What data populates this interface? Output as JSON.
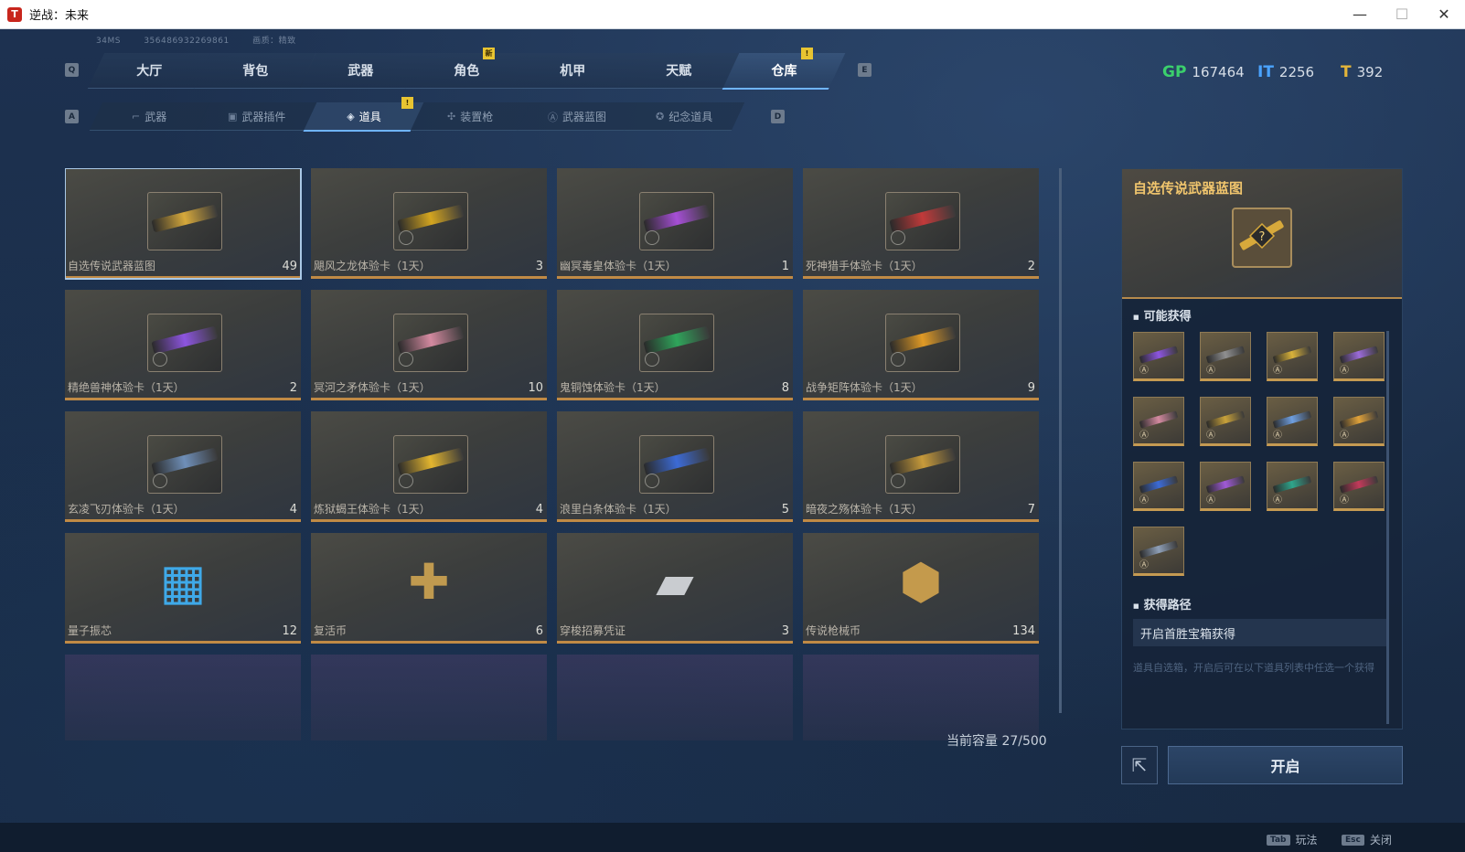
{
  "window": {
    "title": "逆战：未来",
    "app_icon_glyph": "T"
  },
  "top_info": {
    "ping": "34MS",
    "id": "356486932269861",
    "quality": "画质：精致"
  },
  "keys": {
    "prev_tab": "Q",
    "next_tab": "E",
    "prev_sub": "A",
    "next_sub": "D"
  },
  "nav": {
    "tabs": [
      {
        "label": "大厅",
        "active": false
      },
      {
        "label": "背包",
        "active": false
      },
      {
        "label": "武器",
        "active": false
      },
      {
        "label": "角色",
        "active": false,
        "badge": "新"
      },
      {
        "label": "机甲",
        "active": false
      },
      {
        "label": "天赋",
        "active": false
      },
      {
        "label": "仓库",
        "active": true,
        "badge": "!"
      }
    ]
  },
  "currencies": [
    {
      "icon": "gp-icon",
      "symbol": "GP",
      "value": "167464",
      "color": "#3bd06c"
    },
    {
      "icon": "ticket-icon",
      "symbol": "IT",
      "value": "2256",
      "color": "#4aa3ff"
    },
    {
      "icon": "coin-icon",
      "symbol": "T",
      "value": "392",
      "color": "#e3b53a"
    }
  ],
  "subnav": {
    "tabs": [
      {
        "label": "武器",
        "icon": "gun-icon",
        "glyph": "⌐",
        "active": false
      },
      {
        "label": "武器插件",
        "icon": "plugin-icon",
        "glyph": "▣",
        "active": false
      },
      {
        "label": "道具",
        "icon": "item-icon",
        "glyph": "◈",
        "active": true,
        "badge": "!"
      },
      {
        "label": "装置枪",
        "icon": "turret-icon",
        "glyph": "✣",
        "active": false
      },
      {
        "label": "武器蓝图",
        "icon": "blueprint-icon",
        "glyph": "Ⓐ",
        "active": false
      },
      {
        "label": "纪念道具",
        "icon": "medal-icon",
        "glyph": "✪",
        "active": false
      }
    ]
  },
  "items": [
    {
      "name": "自选传说武器蓝图",
      "count": "49",
      "kind": "blueprint",
      "color": "#d7a93b",
      "selected": true
    },
    {
      "name": "飓风之龙体验卡（1天）",
      "count": "3",
      "kind": "weapon",
      "color": "#d4a520"
    },
    {
      "name": "幽冥毒皇体验卡（1天）",
      "count": "1",
      "kind": "weapon",
      "color": "#a64fd6"
    },
    {
      "name": "死神猎手体验卡（1天）",
      "count": "2",
      "kind": "weapon",
      "color": "#c23a3a"
    },
    {
      "name": "精绝兽神体验卡（1天）",
      "count": "2",
      "kind": "weapon",
      "color": "#8d55e0"
    },
    {
      "name": "冥河之矛体验卡（1天）",
      "count": "10",
      "kind": "weapon",
      "color": "#d48aa0"
    },
    {
      "name": "鬼铜蚀体验卡（1天）",
      "count": "8",
      "kind": "weapon",
      "color": "#2fa55b"
    },
    {
      "name": "战争矩阵体验卡（1天）",
      "count": "9",
      "kind": "weapon",
      "color": "#e09a25"
    },
    {
      "name": "玄凌飞刃体验卡（1天）",
      "count": "4",
      "kind": "weapon",
      "color": "#6f8fb8"
    },
    {
      "name": "炼狱蝎王体验卡（1天）",
      "count": "4",
      "kind": "weapon",
      "color": "#e3b52f"
    },
    {
      "name": "浪里白条体验卡（1天）",
      "count": "5",
      "kind": "weapon",
      "color": "#3c6bd6"
    },
    {
      "name": "暗夜之殇体验卡（1天）",
      "count": "7",
      "kind": "weapon",
      "color": "#c79a3a"
    },
    {
      "name": "量子振芯",
      "count": "12",
      "kind": "chip",
      "color": "#3fa9e8",
      "glyph": "▦"
    },
    {
      "name": "复活币",
      "count": "6",
      "kind": "coin",
      "color": "#c09a4f",
      "glyph": "✚"
    },
    {
      "name": "穿梭招募凭证",
      "count": "3",
      "kind": "ticket",
      "color": "#c9ccd0",
      "glyph": "▰"
    },
    {
      "name": "传说枪械币",
      "count": "134",
      "kind": "legend-coin",
      "color": "#c49a4c",
      "glyph": "⬢"
    }
  ],
  "detail": {
    "title": "自选传说武器蓝图",
    "possible_label": "可能获得",
    "possible": [
      "#8d55e0",
      "#8f8f90",
      "#d9b23a",
      "#9b6bd8",
      "#d48aa0",
      "#c9a23a",
      "#6f9fe0",
      "#e0a23a",
      "#3c6bd6",
      "#a05ad6",
      "#2fa58b",
      "#c23a5a",
      "#8fa0b8"
    ],
    "route_label": "获得路径",
    "route": "开启首胜宝箱获得",
    "description": "道具自选箱，开启后可在以下道具列表中任选一个获得"
  },
  "capacity": "当前容量 27/500",
  "open_button": "开启",
  "footer": {
    "tab_key": "Tab",
    "tab_label": "玩法",
    "esc_key": "Esc",
    "esc_label": "关闭"
  }
}
